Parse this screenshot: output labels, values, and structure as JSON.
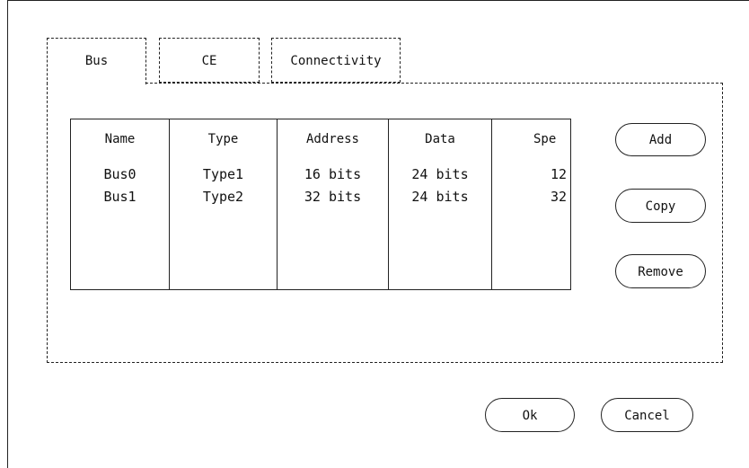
{
  "tabs": {
    "bus": "Bus",
    "ce": "CE",
    "connectivity": "Connectivity"
  },
  "table": {
    "headers": [
      "Name",
      "Type",
      "Address",
      "Data",
      "Spe"
    ],
    "rows": [
      [
        "Bus0",
        "Type1",
        "16 bits",
        "24 bits",
        "12"
      ],
      [
        "Bus1",
        "Type2",
        "32 bits",
        "24 bits",
        "32"
      ]
    ]
  },
  "side_buttons": {
    "add": "Add",
    "copy": "Copy",
    "remove": "Remove"
  },
  "footer": {
    "ok": "Ok",
    "cancel": "Cancel"
  }
}
